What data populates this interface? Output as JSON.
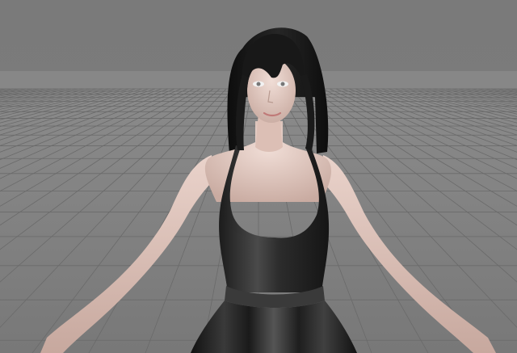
{
  "viewport": {
    "background_top": "#7c7c7c",
    "horizon_band": "#8a8a8a",
    "floor_color": "#828282",
    "grid_line_color": "#6a6a6a"
  },
  "scene": {
    "subject": "3d-character-model",
    "hair_color": "#141414",
    "skin_color": "#e2c8bf",
    "dress_color": "#2b2b2b"
  }
}
